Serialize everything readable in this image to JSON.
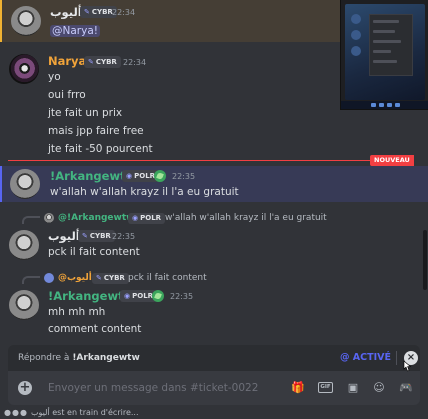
{
  "messages": [
    {
      "author": "أليوب",
      "tag": "CYBR",
      "time": "22:34",
      "lines": [
        "@Narya!"
      ]
    },
    {
      "author": "Narya!",
      "tag": "CYBR",
      "time": "22:34",
      "lines": [
        "yo",
        "oui frro",
        "jte fait un prix",
        "mais jpp faire free",
        "jte fait -50 pourcent"
      ]
    },
    {
      "author": "!Arkangewtw",
      "tag": "POLR",
      "time": "22:35",
      "lines": [
        "w'allah w'allah krayz il l'a eu gratuit"
      ]
    },
    {
      "reply": {
        "author": "@!Arkangewtw",
        "tag": "POLR",
        "text": "w'allah w'allah krayz il l'a eu gratuit"
      },
      "author": "أليوب",
      "tag": "CYBR",
      "time": "22:35",
      "lines": [
        "pck il fait content"
      ]
    },
    {
      "reply": {
        "author": "@أليوب",
        "tag": "CYBR",
        "text": "pck il fait content"
      },
      "author": "!Arkangewtw",
      "tag": "POLR",
      "time": "22:35",
      "lines": [
        "mh mh mh",
        "comment content"
      ]
    }
  ],
  "new_divider": "NOUVEAU",
  "reply_banner": {
    "prefix": "Répondre à",
    "target": "!Arkangewtw",
    "mention_toggle": "@ ACTIVÉ"
  },
  "composer": {
    "placeholder": "Envoyer un message dans #ticket-0022",
    "icons": [
      "gift-icon",
      "gif-icon",
      "sticker-icon",
      "emoji-icon",
      "controller-icon"
    ]
  },
  "typing": {
    "user": "أليوب",
    "text": "est en train d'écrire..."
  },
  "colors": {
    "background": "#313338",
    "accent": "#5865f2",
    "green_name": "#43b581",
    "orange_name": "#f0a33a",
    "new_red": "#f23f42"
  }
}
